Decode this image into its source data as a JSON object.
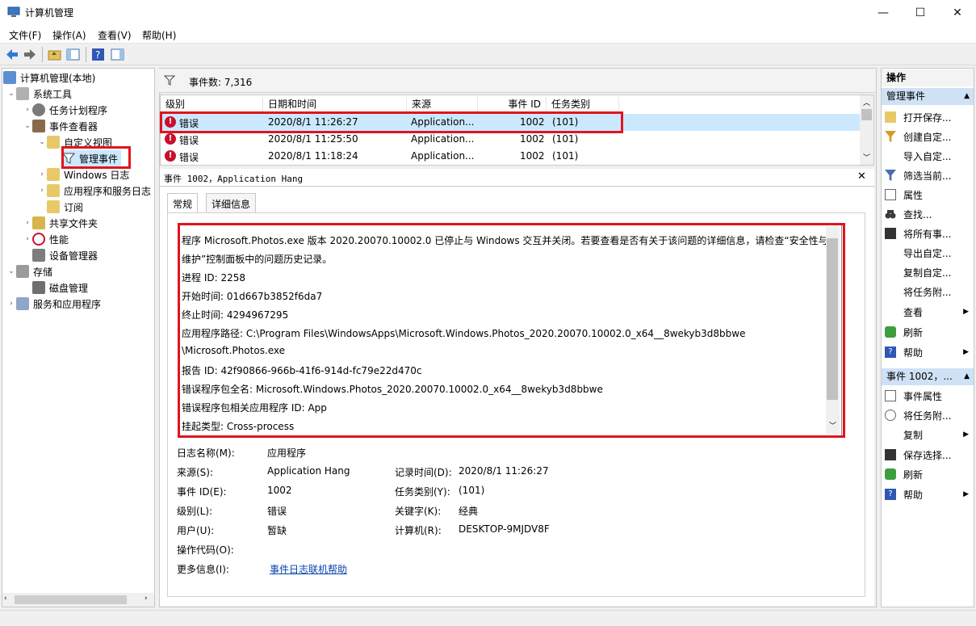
{
  "window": {
    "title": "计算机管理",
    "minimize": "—",
    "maximize": "☐",
    "close": "✕"
  },
  "menu": [
    "文件(F)",
    "操作(A)",
    "查看(V)",
    "帮助(H)"
  ],
  "tree": {
    "root": "计算机管理(本地)",
    "system_tools": "系统工具",
    "task_scheduler": "任务计划程序",
    "event_viewer": "事件查看器",
    "custom_views": "自定义视图",
    "admin_events": "管理事件",
    "windows_logs": "Windows 日志",
    "app_service_logs": "应用程序和服务日志",
    "subscriptions": "订阅",
    "shared_folders": "共享文件夹",
    "performance": "性能",
    "device_manager": "设备管理器",
    "storage": "存储",
    "disk_management": "磁盘管理",
    "services_apps": "服务和应用程序"
  },
  "filter": {
    "event_count_label": "事件数: 7,316"
  },
  "event_columns": [
    "级别",
    "日期和时间",
    "来源",
    "事件 ID",
    "任务类别"
  ],
  "events": [
    {
      "level": "错误",
      "datetime": "2020/8/1 11:26:27",
      "source": "Application...",
      "id": "1002",
      "category": "(101)"
    },
    {
      "level": "错误",
      "datetime": "2020/8/1 11:25:50",
      "source": "Application...",
      "id": "1002",
      "category": "(101)"
    },
    {
      "level": "错误",
      "datetime": "2020/8/1 11:18:24",
      "source": "Application...",
      "id": "1002",
      "category": "(101)"
    }
  ],
  "detail": {
    "header": "事件 1002，Application Hang",
    "tab_general": "常规",
    "tab_details": "详细信息",
    "description_lines": [
      "程序 Microsoft.Photos.exe 版本 2020.20070.10002.0 已停止与 Windows 交互并关闭。若要查看是否有关于该问题的详细信息，请检查“安全性与",
      "维护”控制面板中的问题历史记录。",
      "进程 ID: 2258",
      "开始时间: 01d667b3852f6da7",
      "终止时间: 4294967295",
      "应用程序路径: C:\\Program Files\\WindowsApps\\Microsoft.Windows.Photos_2020.20070.10002.0_x64__8wekyb3d8bbwe",
      "\\Microsoft.Photos.exe",
      "报告 ID: 42f90866-966b-41f6-914d-fc79e22d470c",
      "错误程序包全名: Microsoft.Windows.Photos_2020.20070.10002.0_x64__8wekyb3d8bbwe",
      "错误程序包相关应用程序 ID: App",
      "挂起类型: Cross-process"
    ],
    "fields": {
      "log_name_label": "日志名称(M):",
      "log_name": "应用程序",
      "source_label": "来源(S):",
      "source": "Application Hang",
      "logged_label": "记录时间(D):",
      "logged": "2020/8/1 11:26:27",
      "event_id_label": "事件 ID(E):",
      "event_id": "1002",
      "task_label": "任务类别(Y):",
      "task": "(101)",
      "level_label": "级别(L):",
      "level": "错误",
      "keywords_label": "关键字(K):",
      "keywords": "经典",
      "user_label": "用户(U):",
      "user": "暂缺",
      "computer_label": "计算机(R):",
      "computer": "DESKTOP-9MJDV8F",
      "opcode_label": "操作代码(O):",
      "more_info_label": "更多信息(I):",
      "more_info_link": "事件日志联机帮助"
    }
  },
  "actions": {
    "header": "操作",
    "section1": "管理事件",
    "items1": [
      "打开保存...",
      "创建自定...",
      "导入自定...",
      "筛选当前...",
      "属性",
      "查找...",
      "将所有事...",
      "导出自定...",
      "复制自定...",
      "将任务附...",
      "查看",
      "刷新",
      "帮助"
    ],
    "section2": "事件 1002，...",
    "items2": [
      "事件属性",
      "将任务附...",
      "复制",
      "保存选择...",
      "刷新",
      "帮助"
    ]
  },
  "colors": {
    "accent_header": "#cfe1f5",
    "selected_row": "#cce8ff",
    "error": "#c8102e",
    "highlight_box": "#e0141e"
  }
}
